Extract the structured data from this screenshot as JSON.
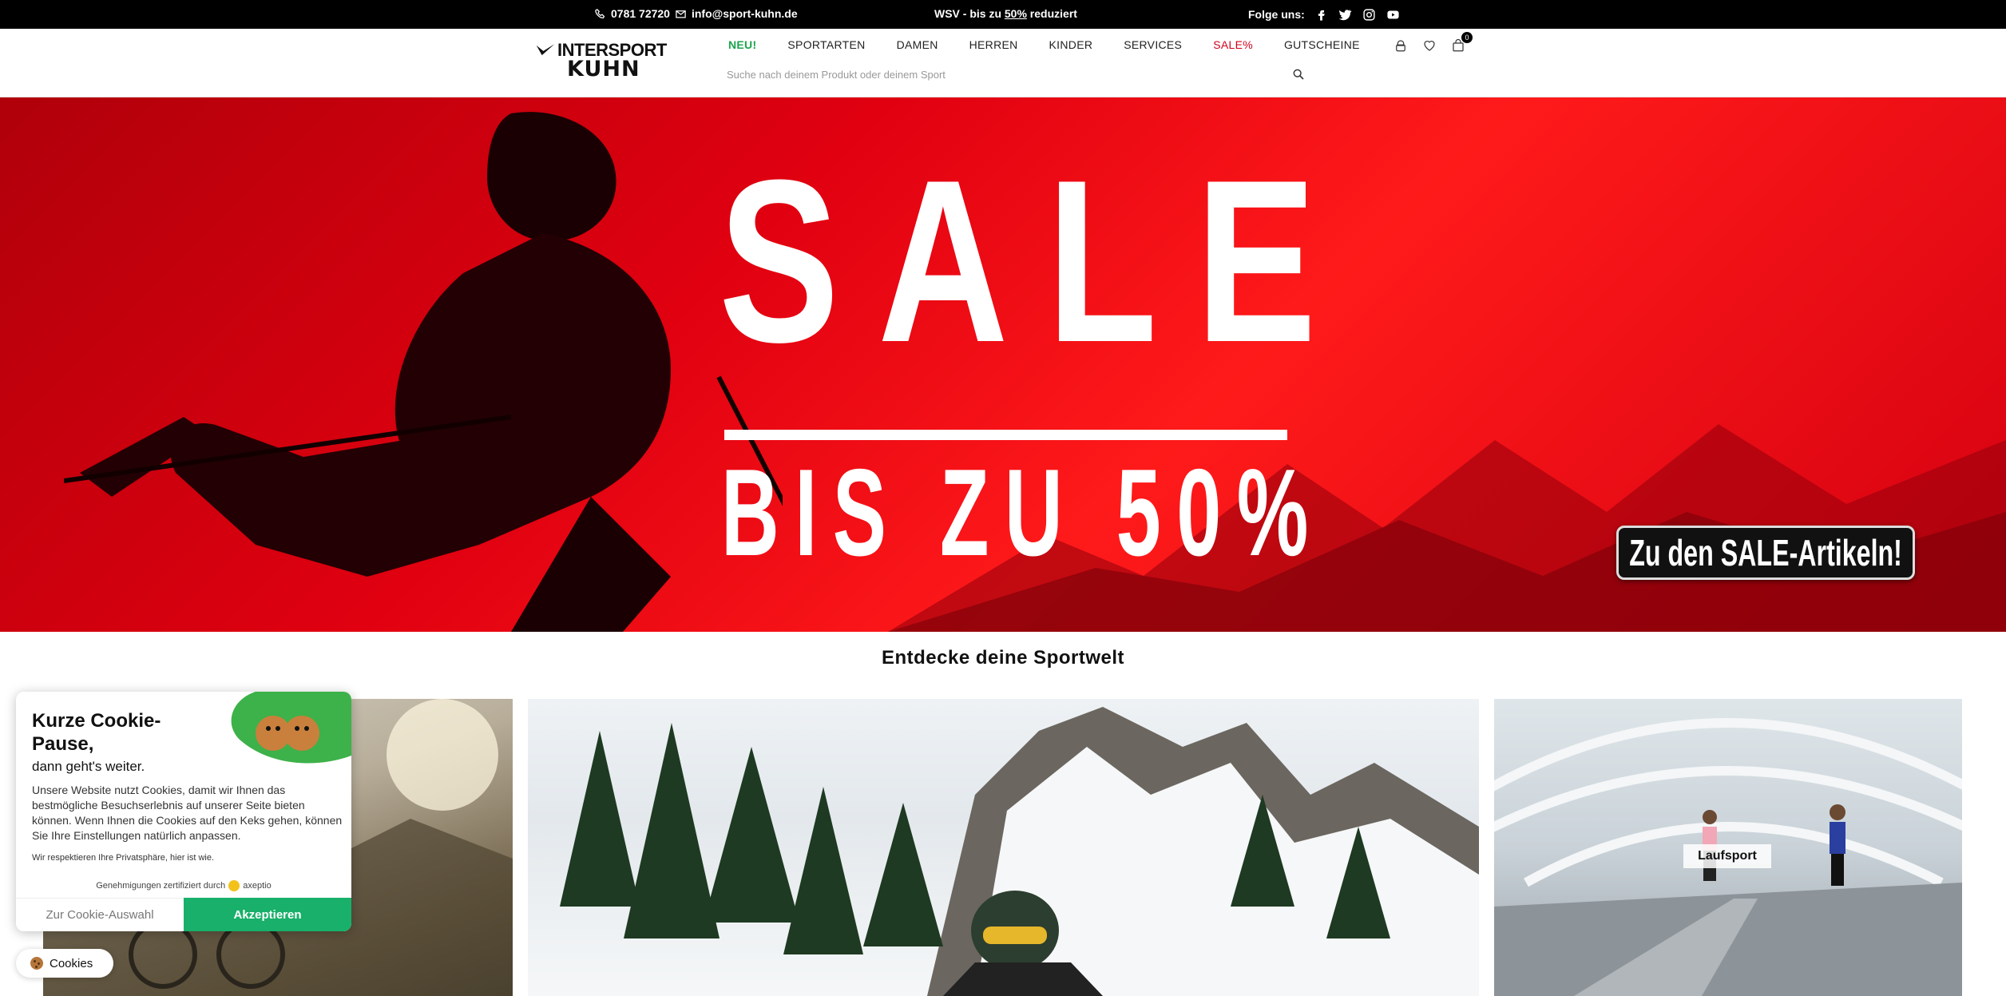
{
  "topbar": {
    "phone": "0781 72720",
    "email": "info@sport-kuhn.de",
    "promo_prefix": "WSV - bis zu ",
    "promo_highlight": "50%",
    "promo_suffix": " reduziert",
    "follow_label": "Folge uns:",
    "social_icons": [
      "facebook-icon",
      "twitter-icon",
      "instagram-icon",
      "youtube-icon"
    ]
  },
  "logo": {
    "line1": "INTERSPORT",
    "line2": "KUHN"
  },
  "nav": {
    "items": [
      "NEU!",
      "SPORTARTEN",
      "DAMEN",
      "HERREN",
      "KINDER",
      "SERVICES",
      "SALE%",
      "GUTSCHEINE"
    ]
  },
  "search": {
    "placeholder": "Suche nach deinem Produkt oder deinem Sport"
  },
  "header_icons": {
    "cart_count": "0"
  },
  "hero": {
    "headline": "SALE",
    "subline": "BIS ZU 50%",
    "button": "Zu den SALE-Artikeln!"
  },
  "section": {
    "title": "Entdecke deine Sportwelt"
  },
  "cards": {
    "running_label": "Laufsport"
  },
  "cookie": {
    "title": "Kurze Cookie-Pause,",
    "subtitle": "dann geht's weiter.",
    "body": "Unsere Website nutzt Cookies, damit wir Ihnen das bestmögliche Besuchserlebnis auf unserer Seite bieten können. Wenn Ihnen die Cookies auf den Keks gehen, können Sie Ihre Einstellungen natürlich anpassen.",
    "privacy": "Wir respektieren Ihre Privatsphäre, hier ist wie.",
    "cert": "Genehmigungen zertifiziert durch",
    "cert_brand": "axeptio",
    "choice_button": "Zur Cookie-Auswahl",
    "accept_button": "Akzeptieren",
    "pill_label": "Cookies"
  },
  "colors": {
    "accent_green": "#18b06a",
    "sale_red": "#d0021b",
    "new_green": "#1aa44b"
  }
}
